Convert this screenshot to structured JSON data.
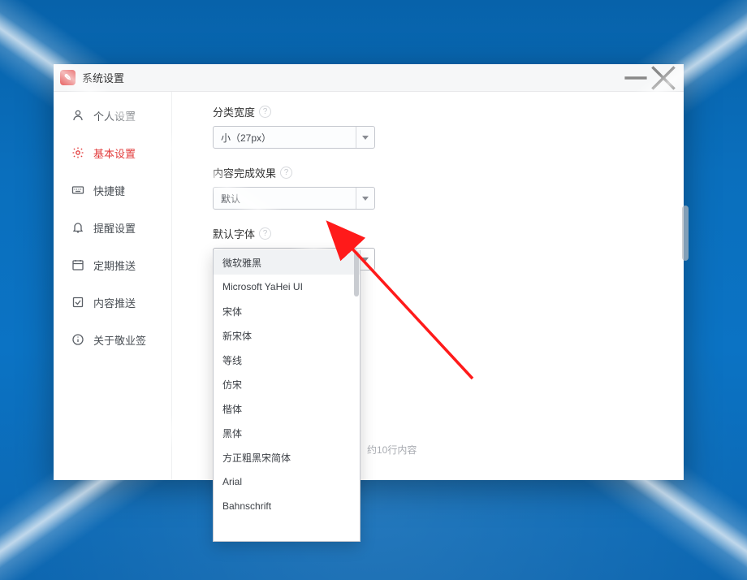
{
  "window": {
    "title": "系统设置"
  },
  "sidebar": {
    "items": [
      {
        "key": "personal",
        "label": "个人设置"
      },
      {
        "key": "basic",
        "label": "基本设置"
      },
      {
        "key": "shortcut",
        "label": "快捷键"
      },
      {
        "key": "remind",
        "label": "提醒设置"
      },
      {
        "key": "schedule",
        "label": "定期推送"
      },
      {
        "key": "content",
        "label": "内容推送"
      },
      {
        "key": "about",
        "label": "关于敬业签"
      }
    ],
    "active_key": "basic"
  },
  "form": {
    "category_width": {
      "label": "分类宽度",
      "value": "小（27px）"
    },
    "done_effect": {
      "label": "内容完成效果",
      "value": "默认"
    },
    "default_font": {
      "label": "默认字体",
      "value": "微软雅黑"
    }
  },
  "font_dropdown": {
    "open": true,
    "hover_index": 0,
    "options": [
      "微软雅黑",
      "Microsoft YaHei UI",
      "宋体",
      "新宋体",
      "等线",
      "仿宋",
      "楷体",
      "黑体",
      "方正粗黑宋简体",
      "Arial",
      "Bahnschrift"
    ]
  },
  "note_text": "约10行内容"
}
